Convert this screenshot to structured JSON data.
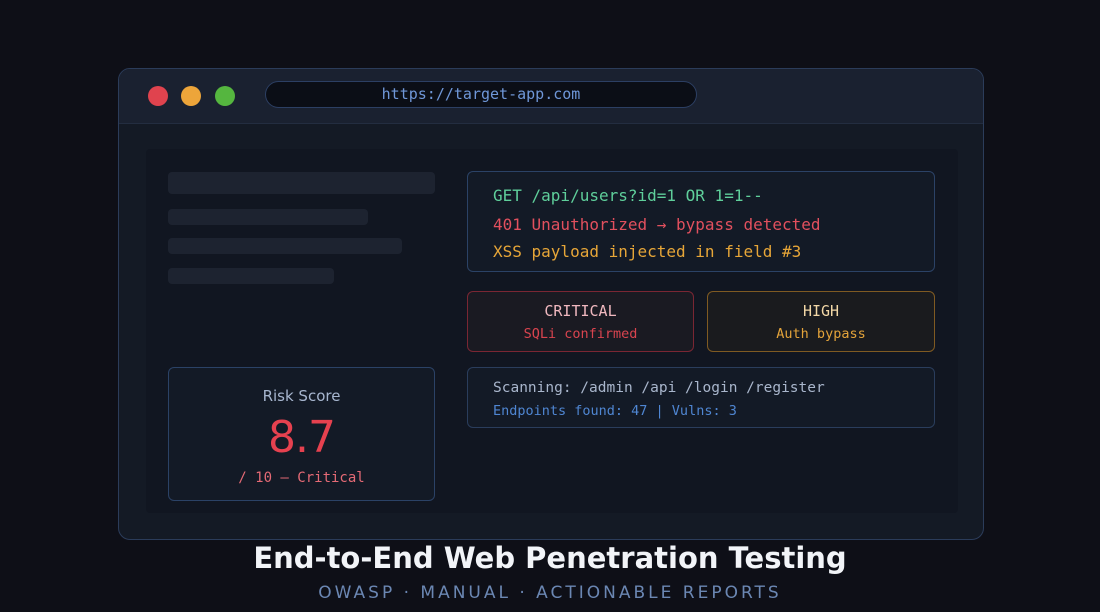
{
  "browser": {
    "url": "https://target-app.com"
  },
  "console": {
    "lines": [
      {
        "text": "GET /api/users?id=1 OR 1=1--",
        "color": "#5fcf9b"
      },
      {
        "text": "401 Unauthorized → bypass detected",
        "color": "#e2505e"
      },
      {
        "text": "XSS payload injected in field #3",
        "color": "#e7a638"
      }
    ]
  },
  "findings": {
    "critical": {
      "title": "CRITICAL",
      "detail": "SQLi confirmed",
      "title_color": "#f0b8bf",
      "detail_color": "#d9444f"
    },
    "high": {
      "title": "HIGH",
      "detail": "Auth bypass",
      "title_color": "#f2d7a6",
      "detail_color": "#e3a33a"
    }
  },
  "scan": {
    "scanning": "Scanning: /admin /api /login /register",
    "summary": "Endpoints found: 47 | Vulns: 3"
  },
  "risk": {
    "label": "Risk Score",
    "value": "8.7",
    "scale": "/ 10 — Critical"
  },
  "footer": {
    "headline": "End-to-End Web Penetration Testing",
    "tagline": "OWASP · MANUAL · ACTIONABLE REPORTS"
  },
  "colors": {
    "background": "#0e0f17",
    "accent": "#4f86d2",
    "critical": "#e6414f",
    "high": "#e3a33a"
  }
}
